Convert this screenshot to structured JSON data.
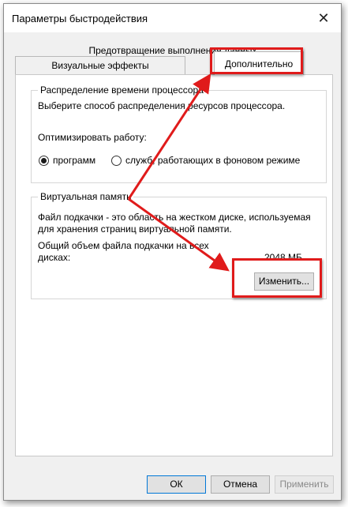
{
  "window": {
    "title": "Параметры быстродействия",
    "close_glyph": "✕"
  },
  "tabs": {
    "row_top": "Предотвращение выполнения данных",
    "visual": "Визуальные эффекты",
    "advanced": "Дополнительно"
  },
  "processor": {
    "caption": "Распределение времени процессора",
    "description": "Выберите способ распределения ресурсов процессора.",
    "optimize_label": "Оптимизировать работу:",
    "option_programs": "программ",
    "option_services": "служб, работающих в фоновом режиме",
    "selected": "программ"
  },
  "virtual_memory": {
    "caption": "Виртуальная память",
    "description_line1": "Файл подкачки - это область на жестком диске, используемая",
    "description_line2": "для хранения страниц виртуальной памяти.",
    "total_label_line1": "Общий объем файла подкачки на всех",
    "total_label_line2": "дисках:",
    "total_value": "2048 МБ",
    "change_button": "Изменить..."
  },
  "footer": {
    "ok": "ОК",
    "cancel": "Отмена",
    "apply": "Применить"
  },
  "annotation": {
    "highlight_color": "#e01b1b"
  }
}
